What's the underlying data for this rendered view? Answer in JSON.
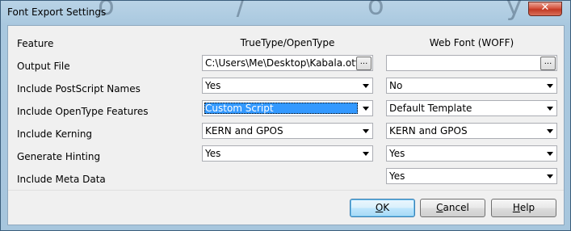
{
  "window": {
    "title": "Font Export Settings",
    "close_glyph": "✕",
    "background_glyphs": "o / ö y ; ; <"
  },
  "columns": {
    "feature": "Feature",
    "truetype": "TrueType/OpenType",
    "woff": "Web Font (WOFF)"
  },
  "rows": {
    "output_file": {
      "label": "Output File",
      "truetype": "C:\\Users\\Me\\Desktop\\Kabala.otf",
      "woff": "",
      "browse": "..."
    },
    "postscript": {
      "label": "Include PostScript Names",
      "truetype": "Yes",
      "woff": "No"
    },
    "opentype": {
      "label": "Include OpenType Features",
      "truetype": "Custom Script",
      "woff": "Default Template"
    },
    "kerning": {
      "label": "Include Kerning",
      "truetype": "KERN and GPOS",
      "woff": "KERN and GPOS"
    },
    "hinting": {
      "label": "Generate Hinting",
      "truetype": "Yes",
      "woff": "Yes"
    },
    "metadata": {
      "label": "Include Meta Data",
      "woff": "Yes"
    }
  },
  "buttons": {
    "ok": {
      "mnemonic": "O",
      "rest": "K"
    },
    "cancel": {
      "mnemonic": "C",
      "rest": "ancel"
    },
    "help": {
      "mnemonic": "H",
      "rest": "elp"
    }
  }
}
